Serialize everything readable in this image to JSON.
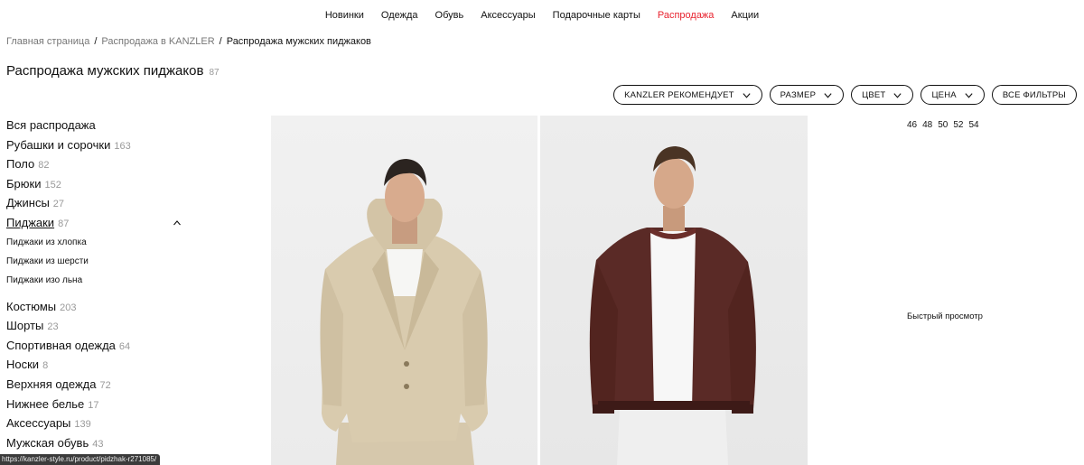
{
  "nav": {
    "items": [
      {
        "label": "Новинки",
        "color": "#111111"
      },
      {
        "label": "Одежда",
        "color": "#111111"
      },
      {
        "label": "Обувь",
        "color": "#111111"
      },
      {
        "label": "Аксессуары",
        "color": "#111111"
      },
      {
        "label": "Подарочные карты",
        "color": "#111111"
      },
      {
        "label": "Распродажа",
        "color": "#e8232f"
      },
      {
        "label": "Акции",
        "color": "#111111"
      }
    ]
  },
  "breadcrumb": {
    "home": "Главная страница",
    "sep": "/",
    "parent": "Распродажа в KANZLER",
    "current": "Распродажа мужских пиджаков"
  },
  "title": {
    "text": "Распродажа мужских пиджаков",
    "count": "87"
  },
  "filters": [
    {
      "label": "KANZLER РЕКОМЕНДУЕТ",
      "icon": "chevron-down-icon"
    },
    {
      "label": "РАЗМЕР",
      "icon": "chevron-down-icon"
    },
    {
      "label": "ЦВЕТ",
      "icon": "chevron-down-icon"
    },
    {
      "label": "ЦЕНА",
      "icon": "chevron-down-icon"
    },
    {
      "label": "ВСЕ ФИЛЬТРЫ"
    }
  ],
  "sidebar": {
    "all": "Вся распродажа",
    "categories_top": [
      {
        "label": "Рубашки и сорочки",
        "count": "163"
      },
      {
        "label": "Поло",
        "count": "82"
      },
      {
        "label": "Брюки",
        "count": "152"
      },
      {
        "label": "Джинсы",
        "count": "27"
      }
    ],
    "active": {
      "label": "Пиджаки",
      "count": "87",
      "icon": "chevron-up-icon"
    },
    "subcategories": [
      "Пиджаки из хлопка",
      "Пиджаки из шерсти",
      "Пиджаки изо льна"
    ],
    "categories_bottom": [
      {
        "label": "Костюмы",
        "count": "203"
      },
      {
        "label": "Шорты",
        "count": "23"
      },
      {
        "label": "Спортивная одежда",
        "count": "64"
      },
      {
        "label": "Носки",
        "count": "8"
      },
      {
        "label": "Верхняя одежда",
        "count": "72"
      },
      {
        "label": "Нижнее белье",
        "count": "17"
      },
      {
        "label": "Аксессуары",
        "count": "139"
      },
      {
        "label": "Мужская обувь",
        "count": "43"
      }
    ]
  },
  "products": [
    {
      "image": "beige-blazer-hood-photo"
    },
    {
      "image": "burgundy-bomber-jacket-photo"
    }
  ],
  "hover_panel": {
    "sizes": [
      "46",
      "48",
      "50",
      "52",
      "54"
    ],
    "quick_view": "Быстрый просмотр"
  },
  "status_bar": {
    "url": "https://kanzler-style.ru/product/pidzhak-r271085/"
  }
}
